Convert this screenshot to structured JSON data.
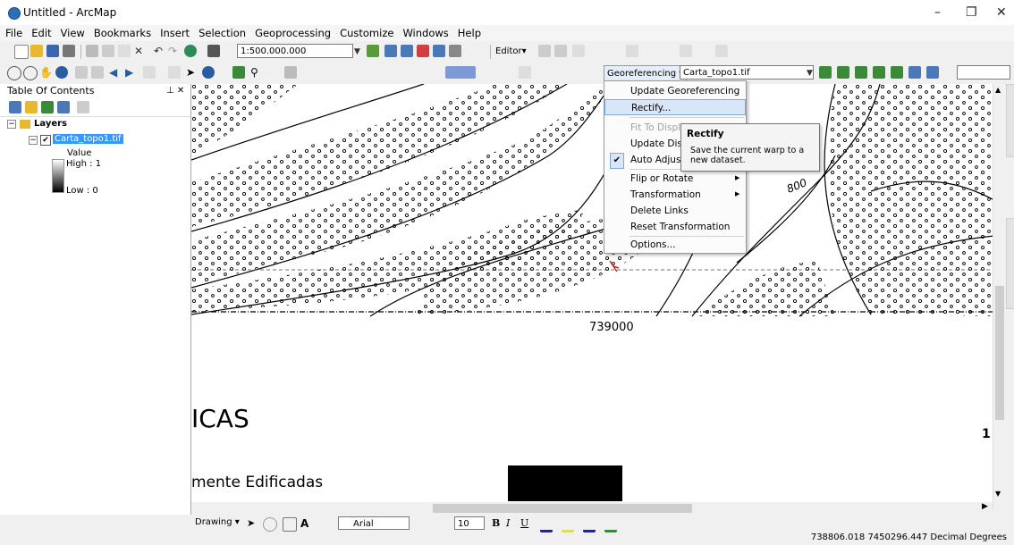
{
  "window": {
    "title": "Untitled - ArcMap",
    "minimize": "–",
    "restore": "❐",
    "close": "✕"
  },
  "menubar": [
    "File",
    "Edit",
    "View",
    "Bookmarks",
    "Insert",
    "Selection",
    "Geoprocessing",
    "Customize",
    "Windows",
    "Help"
  ],
  "toolbar": {
    "scale": "1:500.000.000",
    "editor": "Editor▾"
  },
  "georef": {
    "label": "Georeferencing ▾",
    "layer": "Carta_topo1.tif"
  },
  "toc": {
    "title": "Table Of Contents",
    "pin": "⊥ ✕",
    "layers_label": "Layers",
    "layer_name": "Carta_topo1.tif",
    "value_label": "Value",
    "high": "High : 1",
    "low": "Low : 0"
  },
  "map": {
    "coord_label": "739000",
    "contour_label": "800",
    "text_ticas": "ICAS",
    "text_edificadas": "mente Edificadas",
    "text_right": "1"
  },
  "menu": {
    "items": [
      "Update Georeferencing",
      "Rectify...",
      "Fit To Display",
      "Update Display",
      "Auto Adjust",
      "Flip or Rotate",
      "Transformation",
      "Delete Links",
      "Reset Transformation",
      "Options..."
    ],
    "checkmark": "✔",
    "submenu_arrow": "▶"
  },
  "tooltip": {
    "title": "Rectify",
    "text": "Save the current warp to a new dataset."
  },
  "drawing": {
    "label": "Drawing ▾",
    "font": "Arial",
    "size": "10"
  },
  "status": {
    "coords": "738806.018  7450296.447 Decimal Degrees"
  },
  "colors": {
    "accent": "#3399ff",
    "menu_highlight": "#d8e6f7"
  }
}
